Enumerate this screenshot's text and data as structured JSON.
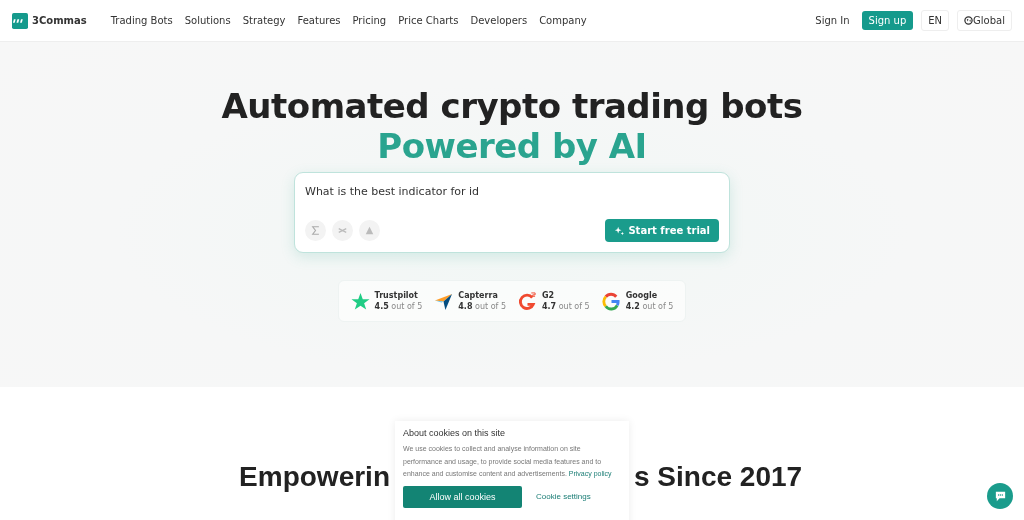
{
  "nav": {
    "brand": "3Commas",
    "links": [
      "Trading Bots",
      "Solutions",
      "Strategy",
      "Features",
      "Pricing",
      "Price Charts",
      "Developers",
      "Company"
    ],
    "sign_in": "Sign In",
    "sign_up": "Sign up",
    "language": "EN",
    "region": "Global"
  },
  "hero": {
    "title": "Automated crypto trading bots",
    "subtitle": "Powered by AI",
    "prompt": {
      "value": "What is the best indicator for id",
      "tools": [
        {
          "kind": "sigma"
        },
        {
          "kind": "shuffle"
        },
        {
          "kind": "triangle"
        }
      ],
      "button": "Start free trial"
    },
    "ratings": [
      {
        "kind": "trustpilot",
        "name": "Trustpilot",
        "score": "4.5",
        "suffix": "out of 5"
      },
      {
        "kind": "capterra",
        "name": "Capterra",
        "score": "4.8",
        "suffix": "out of 5"
      },
      {
        "kind": "g2",
        "name": "G2",
        "score": "4.7",
        "suffix": "out of 5"
      },
      {
        "kind": "google",
        "name": "Google",
        "score": "4.2",
        "suffix": "out of 5"
      }
    ]
  },
  "section_heading": {
    "left": "Empowerin",
    "right": "s Since 2017"
  },
  "cookie_banner": {
    "title": "About cookies on this site",
    "text": "We use cookies to collect and analyse information on site performance and usage, to provide social media features and to enhance and customise content and advertisements.",
    "link": "Privacy policy",
    "accept": "Allow all cookies",
    "settings": "Cookie settings"
  }
}
